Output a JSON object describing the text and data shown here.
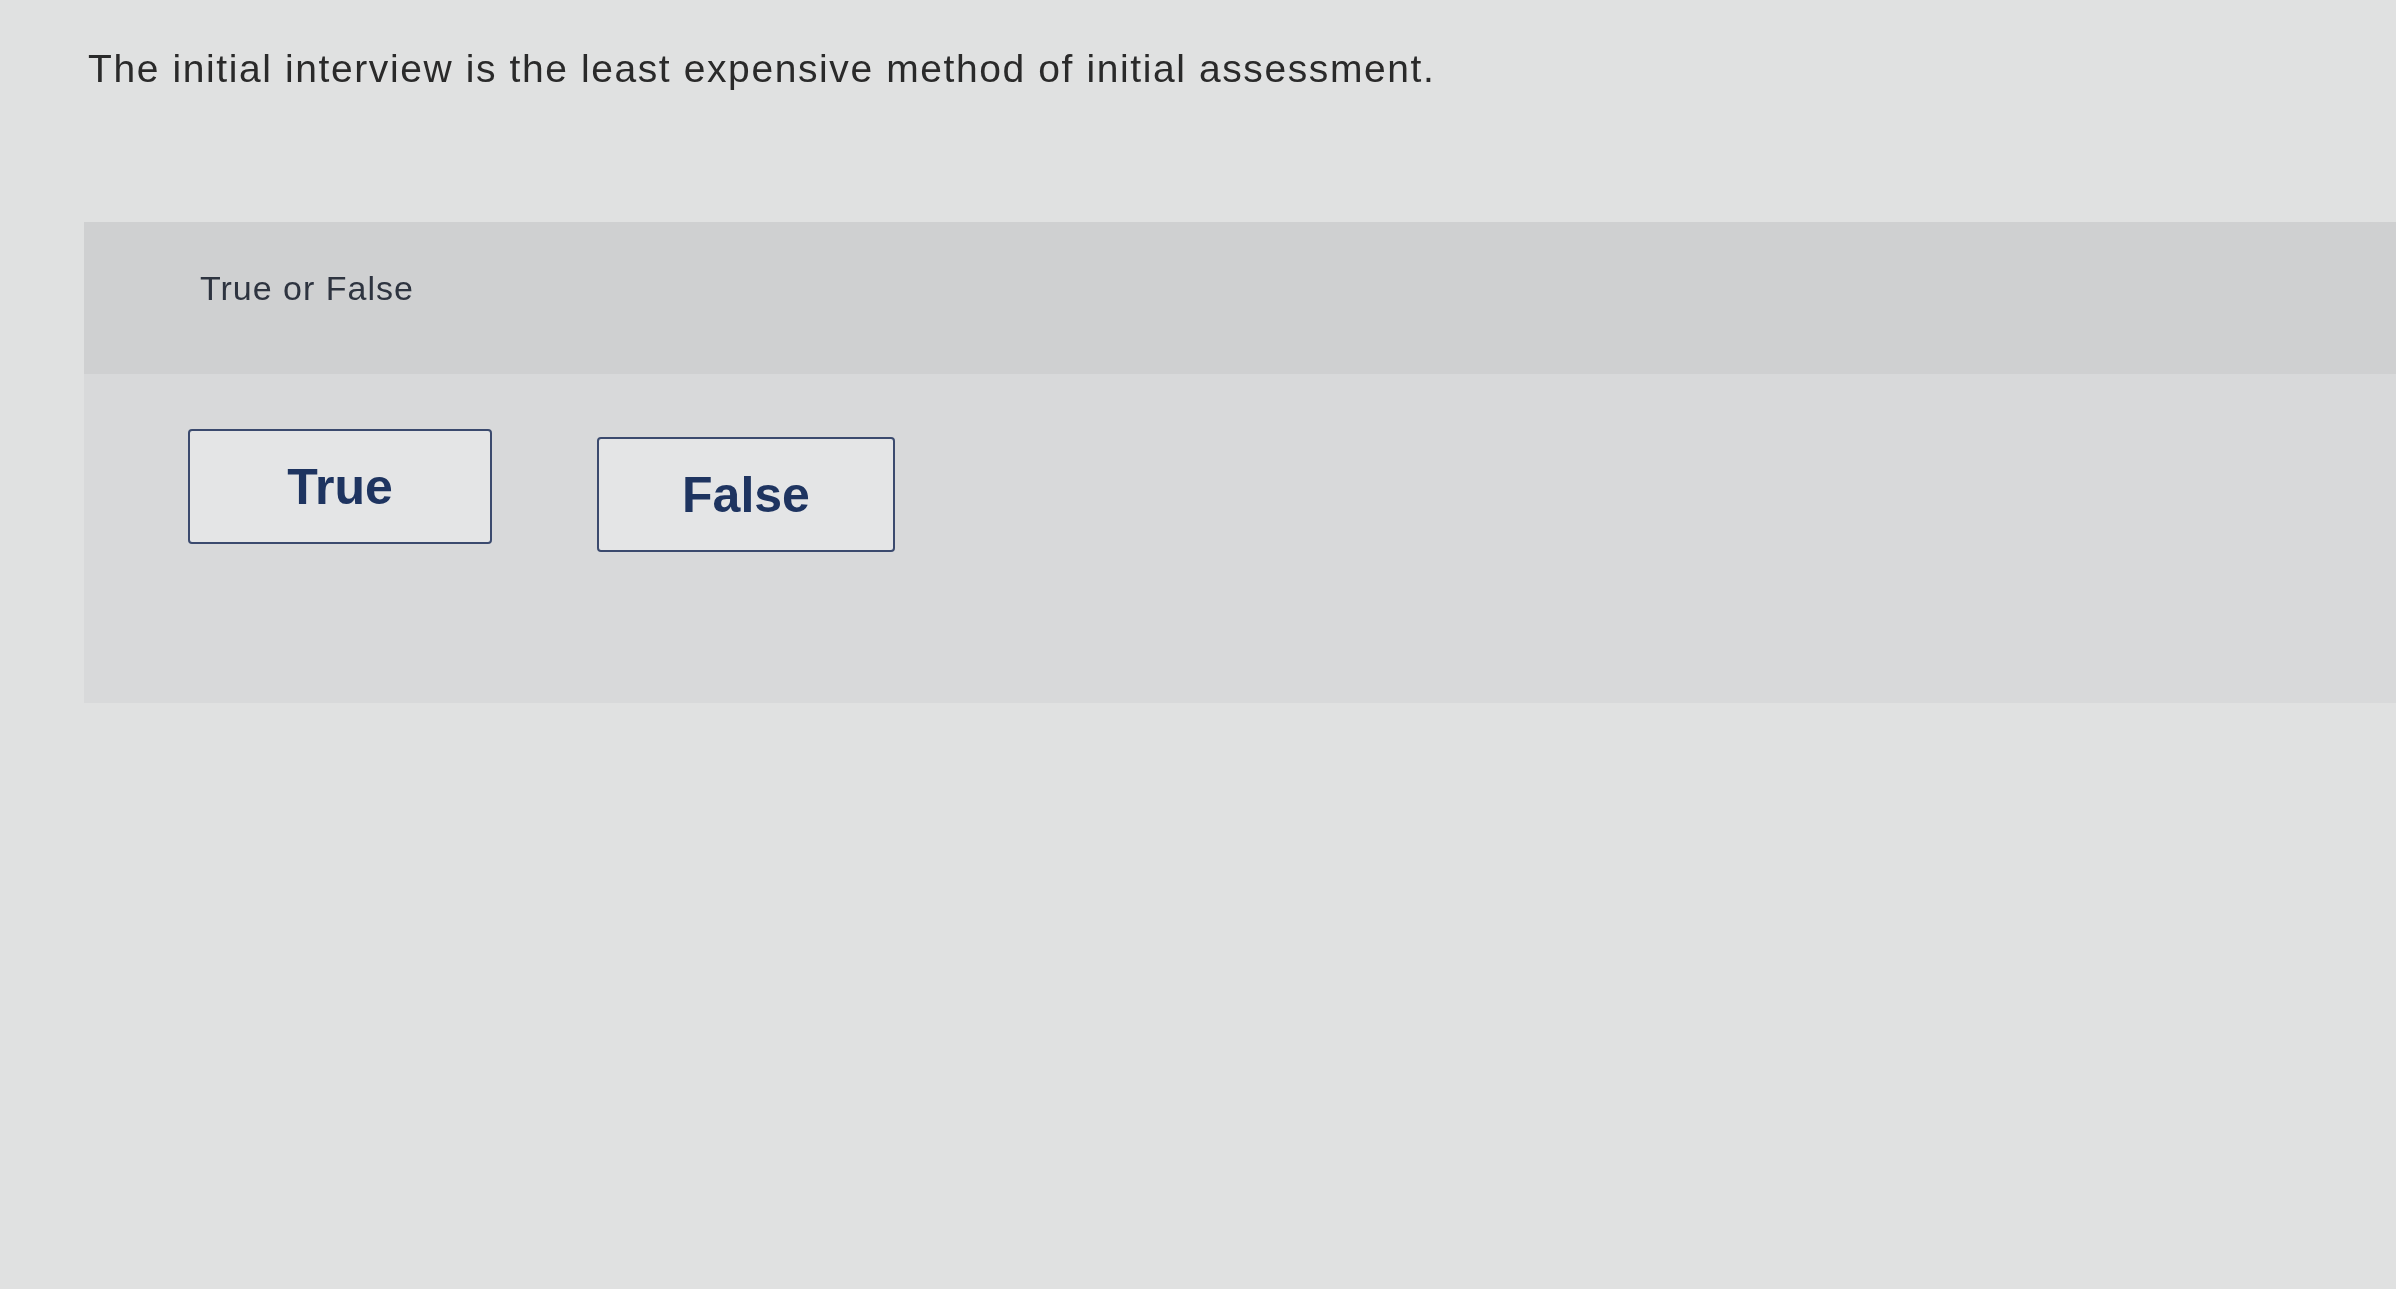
{
  "question": {
    "text": "The initial interview is the least expensive method of initial assessment."
  },
  "answer_panel": {
    "prompt": "True or False",
    "options": [
      {
        "label": "True",
        "selected": false
      },
      {
        "label": "False",
        "selected": false
      }
    ]
  }
}
